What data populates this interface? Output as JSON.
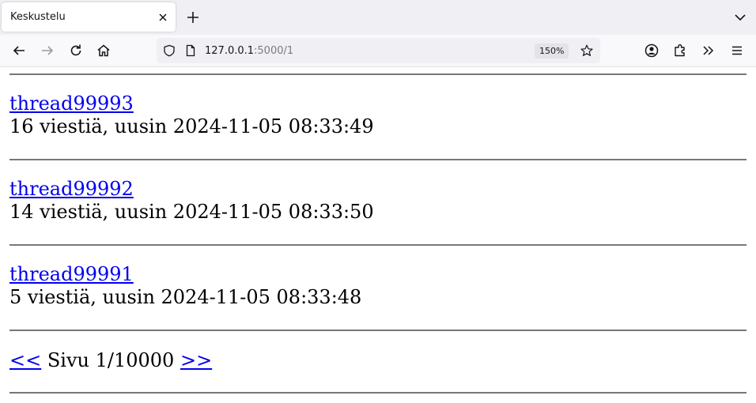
{
  "browser": {
    "tab_title": "Keskustelu",
    "url_host": "127.0.0.1",
    "url_path": ":5000/1",
    "zoom": "150%"
  },
  "threads": [
    {
      "title": "thread99993",
      "meta": "16 viestiä, uusin 2024-11-05 08:33:49"
    },
    {
      "title": "thread99992",
      "meta": "14 viestiä, uusin 2024-11-05 08:33:50"
    },
    {
      "title": "thread99991",
      "meta": "5 viestiä, uusin 2024-11-05 08:33:48"
    }
  ],
  "pagination": {
    "prev_label": "<<",
    "page_text": "Sivu 1/10000",
    "next_label": ">>"
  }
}
